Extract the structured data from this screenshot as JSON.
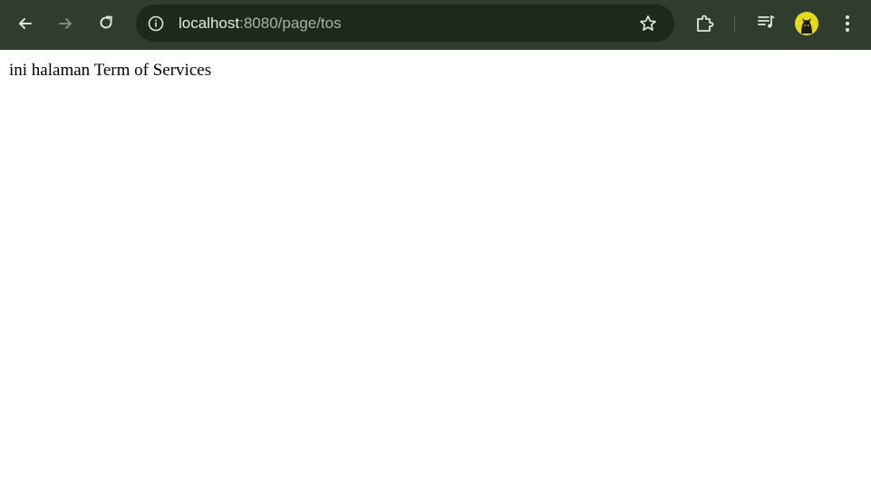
{
  "browser": {
    "url_host": "localhost",
    "url_rest": ":8080/page/tos",
    "icons": {
      "back": "arrow-left-icon",
      "forward": "arrow-right-icon",
      "reload": "reload-icon",
      "site_info": "info-icon",
      "bookmark": "star-icon",
      "extensions": "puzzle-icon",
      "media": "media-queue-icon",
      "profile": "avatar",
      "menu": "kebab-menu-icon"
    },
    "colors": {
      "toolbar": "#2f3d2c",
      "omnibox": "#1c2a19",
      "avatar": "#e5d91a"
    }
  },
  "page": {
    "text": "ini halaman Term of Services"
  }
}
